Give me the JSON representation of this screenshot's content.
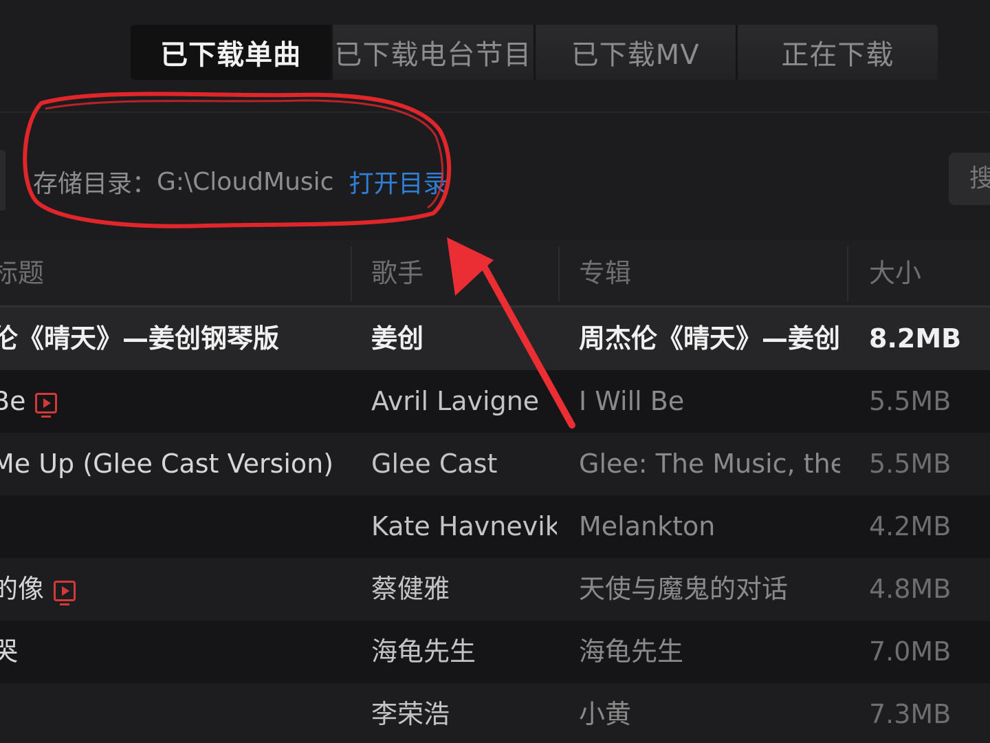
{
  "tabs": [
    {
      "label": "已下载单曲",
      "active": true
    },
    {
      "label": "已下载电台节目",
      "active": false
    },
    {
      "label": "已下载MV",
      "active": false
    },
    {
      "label": "正在下载",
      "active": false
    }
  ],
  "storage": {
    "label": "存储目录：",
    "path": "G:\\CloudMusic",
    "open_link": "打开目录"
  },
  "search_stub_text": "搜",
  "table": {
    "headers": {
      "title": "标题",
      "artist": "歌手",
      "album": "专辑",
      "size": "大小"
    },
    "rows": [
      {
        "title": "伦《晴天》—姜创钢琴版",
        "artist": "姜创",
        "album": "周杰伦《晴天》—姜创...",
        "size": "8.2MB",
        "mv": false,
        "selected": true
      },
      {
        "title": "Be",
        "artist": "Avril Lavigne",
        "album": "I Will Be",
        "size": "5.5MB",
        "mv": true,
        "selected": false
      },
      {
        "title": " Me Up (Glee Cast Version)",
        "artist": "Glee Cast",
        "album": "Glee: The Music, the B...",
        "size": "5.5MB",
        "mv": false,
        "selected": false
      },
      {
        "title": "",
        "artist": "Kate Havnevik",
        "album": "Melankton",
        "size": "4.2MB",
        "mv": false,
        "selected": false
      },
      {
        "title": "的像",
        "artist": "蔡健雅",
        "album": "天使与魔鬼的对话",
        "size": "4.8MB",
        "mv": true,
        "selected": false
      },
      {
        "title": "哭",
        "artist": "海龟先生",
        "album": "海龟先生",
        "size": "7.0MB",
        "mv": false,
        "selected": false
      },
      {
        "title": "",
        "artist": "李荣浩",
        "album": "小黄",
        "size": "7.3MB",
        "mv": false,
        "selected": false
      }
    ]
  },
  "colors": {
    "accent_link": "#2f7fd6",
    "annotation_red": "#e0262b",
    "mv_icon": "#d23a3a"
  }
}
